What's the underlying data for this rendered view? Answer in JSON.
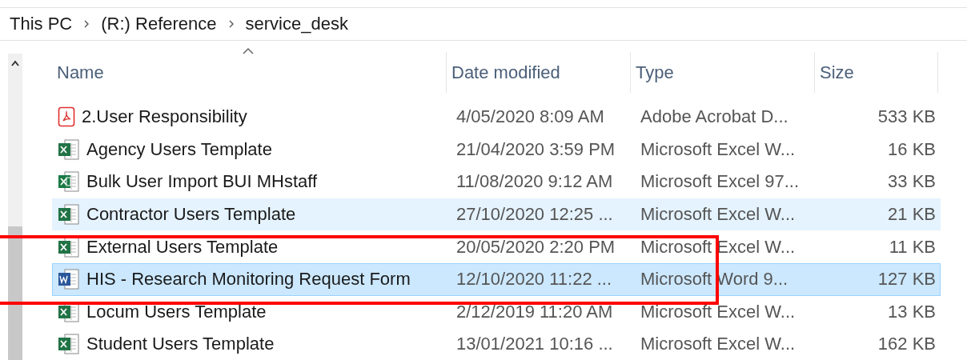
{
  "breadcrumb": [
    "This PC",
    "(R:) Reference",
    "service_desk"
  ],
  "columns": [
    "Name",
    "Date modified",
    "Type",
    "Size"
  ],
  "files": [
    {
      "kind": "pdf",
      "name": "2.User Responsibility",
      "date": "4/05/2020 8:09 AM",
      "type": "Adobe Acrobat D...",
      "size": "533 KB",
      "selected": false,
      "hovered": false
    },
    {
      "kind": "excel",
      "name": "Agency Users Template",
      "date": "21/04/2020 3:59 PM",
      "type": "Microsoft Excel W...",
      "size": "16 KB",
      "selected": false,
      "hovered": false
    },
    {
      "kind": "excel97",
      "name": "Bulk User Import BUI MHstaff",
      "date": "11/08/2020 9:12 AM",
      "type": "Microsoft Excel 97...",
      "size": "33 KB",
      "selected": false,
      "hovered": false
    },
    {
      "kind": "excel",
      "name": "Contractor Users Template",
      "date": "27/10/2020 12:25 ...",
      "type": "Microsoft Excel W...",
      "size": "21 KB",
      "selected": false,
      "hovered": true
    },
    {
      "kind": "excel",
      "name": "External Users Template",
      "date": "20/05/2020 2:20 PM",
      "type": "Microsoft Excel W...",
      "size": "11 KB",
      "selected": false,
      "hovered": false
    },
    {
      "kind": "word",
      "name": "HIS - Research Monitoring Request Form",
      "date": "12/10/2020 11:22 ...",
      "type": "Microsoft Word 9...",
      "size": "127 KB",
      "selected": true,
      "hovered": false
    },
    {
      "kind": "excel",
      "name": "Locum Users Template",
      "date": "2/12/2019 11:20 AM",
      "type": "Microsoft Excel W...",
      "size": "13 KB",
      "selected": false,
      "hovered": false
    },
    {
      "kind": "excel",
      "name": "Student Users Template",
      "date": "13/01/2021 10:16 ...",
      "type": "Microsoft Excel W...",
      "size": "162 KB",
      "selected": false,
      "hovered": false
    }
  ]
}
